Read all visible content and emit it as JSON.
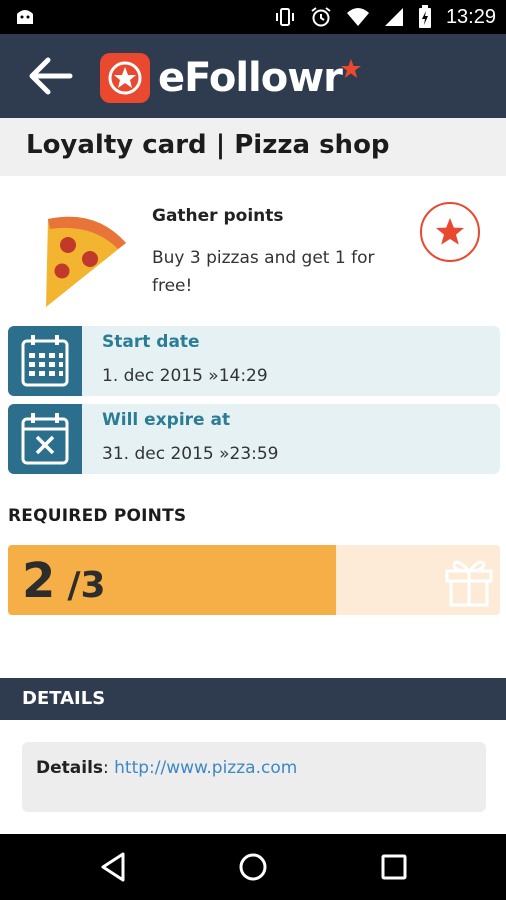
{
  "status_bar": {
    "time": "13:29",
    "icons": [
      "android-icon",
      "vibrate-icon",
      "alarm-icon",
      "wifi-icon",
      "signal-icon",
      "battery-charging-icon"
    ]
  },
  "app_bar": {
    "back_icon": "back-arrow-icon",
    "logo_text": "eFollowr",
    "brand_color": "#e8492f",
    "bar_color": "#2f3b4f"
  },
  "page": {
    "title": "Loyalty card | Pizza shop"
  },
  "offer": {
    "image": "pizza-slice-icon",
    "title": "Gather points",
    "description": "Buy 3 pizzas and get 1 for free!",
    "favorite_icon": "star-icon"
  },
  "dates": {
    "start": {
      "label": "Start date",
      "value": "1. dec 2015 »14:29",
      "icon": "calendar-icon"
    },
    "expire": {
      "label": "Will expire at",
      "value": "31. dec 2015 »23:59",
      "icon": "calendar-cancel-icon"
    }
  },
  "points": {
    "label": "REQUIRED POINTS",
    "current": "2",
    "total_text": "/3",
    "progress_fraction": 0.667,
    "reward_icon": "gift-icon",
    "fill_color": "#f6ae47",
    "track_color": "#fdebd8"
  },
  "details": {
    "header": "DETAILS",
    "key": "Details",
    "separator": ": ",
    "link": "http://www.pizza.com"
  },
  "nav_bar": {
    "buttons": [
      "back-triangle-icon",
      "home-circle-icon",
      "recents-square-icon"
    ]
  }
}
